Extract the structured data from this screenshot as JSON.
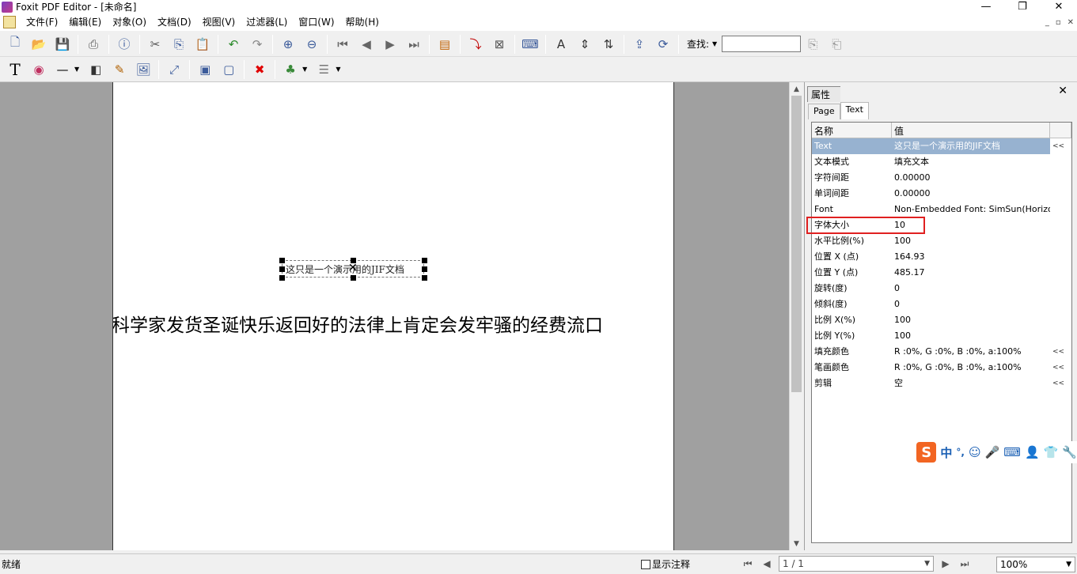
{
  "window": {
    "title": "Foxit PDF Editor - [未命名]",
    "minimize": "—",
    "restore": "❐",
    "close": "✕"
  },
  "menu": {
    "items": [
      "文件(F)",
      "编辑(E)",
      "对象(O)",
      "文档(D)",
      "视图(V)",
      "过滤器(L)",
      "窗口(W)",
      "帮助(H)"
    ],
    "mdi": [
      "_",
      "▫",
      "✕"
    ]
  },
  "toolbar": {
    "find_label": "查找:",
    "find_value": ""
  },
  "document": {
    "selected_text": "这只是一个演示用的JIF文档",
    "body_text": "科学家发货圣诞快乐返回好的法律上肯定会发牢骚的经费流口"
  },
  "properties": {
    "title": "属性",
    "tabs": [
      "Page",
      "Text"
    ],
    "active_tab": "Text",
    "columns": [
      "名称",
      "值"
    ],
    "rows": [
      {
        "name": "Text",
        "value": "这只是一个演示用的JIF文档",
        "more": "<<"
      },
      {
        "name": "文本模式",
        "value": "填充文本",
        "more": ""
      },
      {
        "name": "字符间距",
        "value": "0.00000",
        "more": ""
      },
      {
        "name": "单词间距",
        "value": "0.00000",
        "more": ""
      },
      {
        "name": "Font",
        "value": "Non-Embedded Font: SimSun(Horizontal)",
        "more": ""
      },
      {
        "name": "字体大小",
        "value": "10",
        "more": ""
      },
      {
        "name": "水平比例(%)",
        "value": "100",
        "more": ""
      },
      {
        "name": "位置 X (点)",
        "value": "164.93",
        "more": ""
      },
      {
        "name": "位置 Y (点)",
        "value": "485.17",
        "more": ""
      },
      {
        "name": "旋转(度)",
        "value": "0",
        "more": ""
      },
      {
        "name": "倾斜(度)",
        "value": "0",
        "more": ""
      },
      {
        "name": "比例 X(%)",
        "value": "100",
        "more": ""
      },
      {
        "name": "比例 Y(%)",
        "value": "100",
        "more": ""
      },
      {
        "name": "填充颜色",
        "value": "R :0%, G :0%, B :0%, a:100%",
        "more": "<<"
      },
      {
        "name": "笔画颜色",
        "value": "R :0%, G :0%, B :0%, a:100%",
        "more": "<<"
      },
      {
        "name": "剪辑",
        "value": "空",
        "more": "<<"
      }
    ]
  },
  "ime": {
    "logo": "S",
    "mode": "中",
    "punct": "°,"
  },
  "status": {
    "text": "就绪",
    "show_annotations": "显示注释",
    "page": "1 / 1",
    "zoom": "100%"
  },
  "colors": {
    "selected_row": "#97b2d0",
    "highlight": "#e02020",
    "workspace": "#a0a0a0"
  }
}
